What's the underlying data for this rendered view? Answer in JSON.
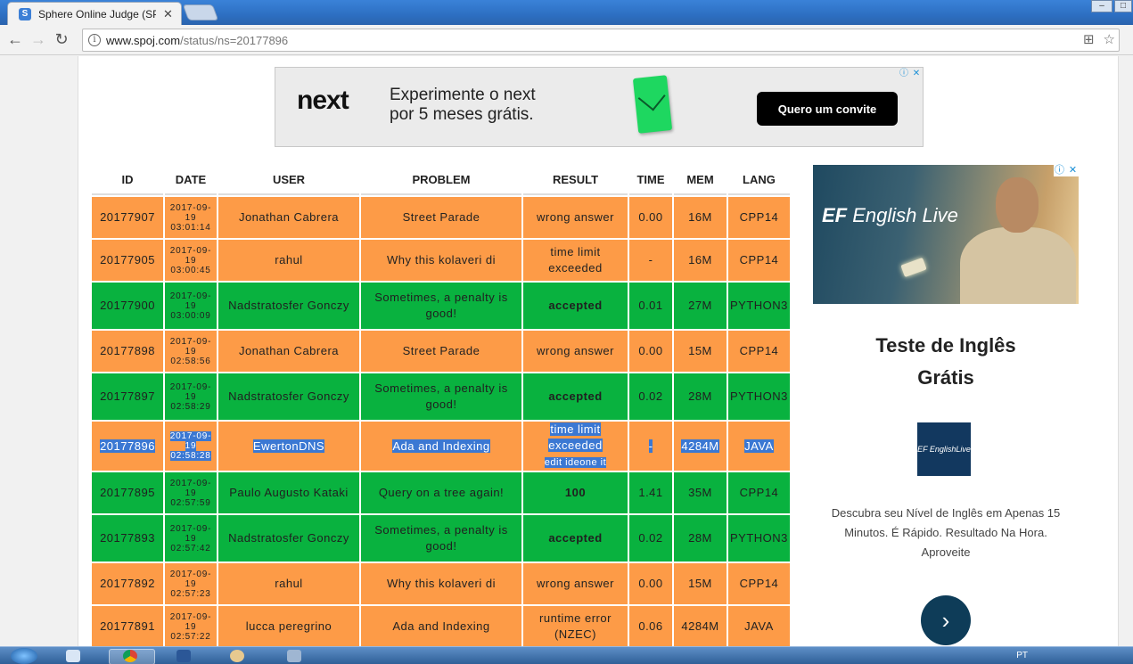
{
  "browser": {
    "tab_title": "Sphere Online Judge (SPOJ)",
    "favicon_letter": "S",
    "url_host": "www.spoj.com",
    "url_path": "/status/ns=20177896"
  },
  "ad_top": {
    "logo": "next",
    "line1": "Experimente o next",
    "line2": "por 5 meses grátis.",
    "cta": "Quero um convite"
  },
  "table": {
    "headers": [
      "ID",
      "DATE",
      "USER",
      "PROBLEM",
      "RESULT",
      "TIME",
      "MEM",
      "LANG"
    ],
    "rows": [
      {
        "id": "20177907",
        "date1": "2017-09-",
        "date2": "19",
        "date3": "03:01:14",
        "user": "Jonathan Cabrera",
        "problem": "Street Parade",
        "result": "wrong answer",
        "time": "0.00",
        "mem": "16M",
        "lang": "CPP14",
        "status": "orange"
      },
      {
        "id": "20177905",
        "date1": "2017-09-",
        "date2": "19",
        "date3": "03:00:45",
        "user": "rahul",
        "problem": "Why this kolaveri di",
        "result": "time limit exceeded",
        "time": "-",
        "mem": "16M",
        "lang": "CPP14",
        "status": "orange"
      },
      {
        "id": "20177900",
        "date1": "2017-09-",
        "date2": "19",
        "date3": "03:00:09",
        "user": "Nadstratosfer Gonczy",
        "problem": "Sometimes, a penalty is good!",
        "result": "accepted",
        "time": "0.01",
        "mem": "27M",
        "lang": "PYTHON3",
        "status": "green"
      },
      {
        "id": "20177898",
        "date1": "2017-09-",
        "date2": "19",
        "date3": "02:58:56",
        "user": "Jonathan Cabrera",
        "problem": "Street Parade",
        "result": "wrong answer",
        "time": "0.00",
        "mem": "15M",
        "lang": "CPP14",
        "status": "orange"
      },
      {
        "id": "20177897",
        "date1": "2017-09-",
        "date2": "19",
        "date3": "02:58:29",
        "user": "Nadstratosfer Gonczy",
        "problem": "Sometimes, a penalty is good!",
        "result": "accepted",
        "time": "0.02",
        "mem": "28M",
        "lang": "PYTHON3",
        "status": "green"
      },
      {
        "id": "20177896",
        "date1": "2017-09-",
        "date2": "19",
        "date3": "02:58:28",
        "user": "EwertonDNS",
        "problem": "Ada and Indexing",
        "result": "time limit exceeded",
        "result_links": "edit    ideone it",
        "time": "-",
        "mem": "4284M",
        "lang": "JAVA",
        "status": "orange",
        "selected": true
      },
      {
        "id": "20177895",
        "date1": "2017-09-",
        "date2": "19",
        "date3": "02:57:59",
        "user": "Paulo Augusto Kataki",
        "problem": "Query on a tree again!",
        "result": "100",
        "time": "1.41",
        "mem": "35M",
        "lang": "CPP14",
        "status": "green"
      },
      {
        "id": "20177893",
        "date1": "2017-09-",
        "date2": "19",
        "date3": "02:57:42",
        "user": "Nadstratosfer Gonczy",
        "problem": "Sometimes, a penalty is good!",
        "result": "accepted",
        "time": "0.02",
        "mem": "28M",
        "lang": "PYTHON3",
        "status": "green"
      },
      {
        "id": "20177892",
        "date1": "2017-09-",
        "date2": "19",
        "date3": "02:57:23",
        "user": "rahul",
        "problem": "Why this kolaveri di",
        "result": "wrong answer",
        "time": "0.00",
        "mem": "15M",
        "lang": "CPP14",
        "status": "orange"
      },
      {
        "id": "20177891",
        "date1": "2017-09-",
        "date2": "19",
        "date3": "02:57:22",
        "user": "lucca peregrino",
        "problem": "Ada and Indexing",
        "result": "runtime error (NZEC)",
        "time": "0.06",
        "mem": "4284M",
        "lang": "JAVA",
        "status": "orange"
      }
    ]
  },
  "ad_side": {
    "brand": "EF",
    "brand_name": "English Live",
    "logo_text": "EF EnglishLive",
    "title": "Teste de Inglês Grátis",
    "body": "Descubra seu Nível de Inglês em Apenas 15 Minutos. É Rápido. Resultado Na Hora. Aproveite"
  },
  "taskbar": {
    "lang": "PT"
  },
  "colors": {
    "orange_row": "#fd9b47",
    "green_row": "#09b23f",
    "selection": "#3b78d3"
  }
}
